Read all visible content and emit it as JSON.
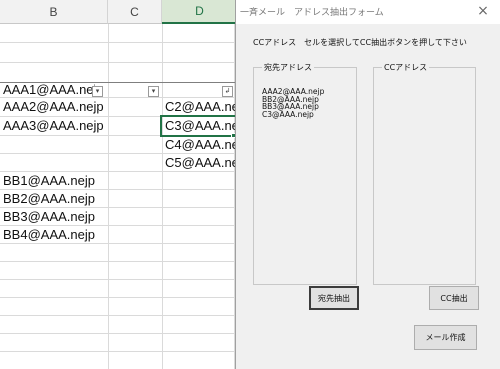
{
  "sheet": {
    "columns": [
      "B",
      "C",
      "D"
    ],
    "selected_column": "D",
    "column_b": [
      "AAA1@AAA.nejp",
      "AAA2@AAA.nejp",
      "AAA3@AAA.nejp",
      "",
      "BB1@AAA.nejp",
      "BB2@AAA.nejp",
      "BB3@AAA.nejp",
      "BB4@AAA.nejp"
    ],
    "column_d": [
      "",
      "C2@AAA.nejp",
      "C3@AAA.nejp",
      "C4@AAA.nejp",
      "C5@AAA.nejp"
    ],
    "selected_cell": "D"
  },
  "dialog": {
    "title": "一斉メール　アドレス抽出フォーム",
    "close_glyph": "×",
    "instruction": "CCアドレス　セルを選択してCC抽出ボタンを押して下さい",
    "to_group_label": "宛先アドレス",
    "to_addresses": [
      "AAA2@AAA.nejp",
      "BB2@AAA.nejp",
      "BB3@AAA.nejp",
      "C3@AAA.nejp"
    ],
    "cc_group_label": "CCアドレス",
    "cc_addresses": [],
    "to_extract_button": "宛先抽出",
    "cc_extract_button": "CC抽出",
    "create_mail_button": "メール作成"
  }
}
